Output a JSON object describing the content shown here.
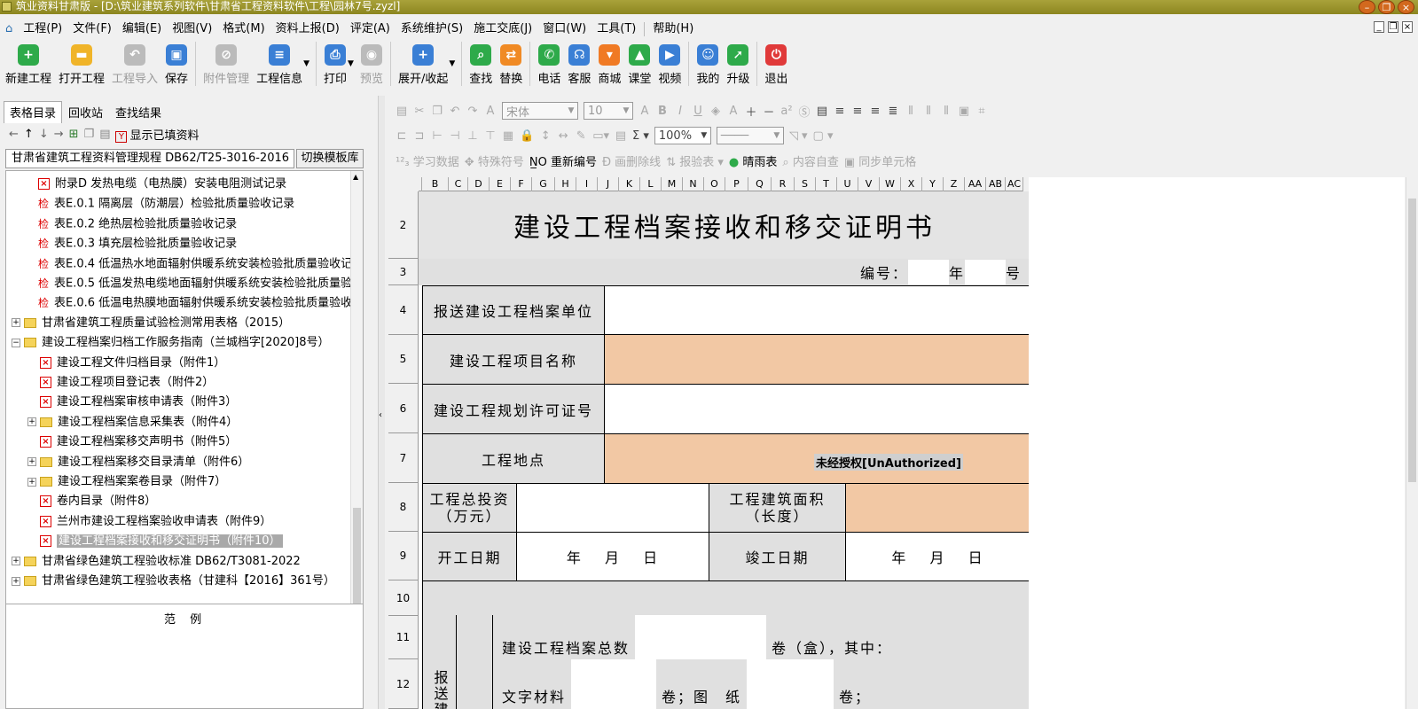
{
  "window": {
    "title": "筑业资料甘肃版 - [D:\\筑业建筑系列软件\\甘肃省工程资料软件\\工程\\园林7号.zyzl]"
  },
  "menu": [
    "工程(P)",
    "文件(F)",
    "编辑(E)",
    "视图(V)",
    "格式(M)",
    "资料上报(D)",
    "评定(A)",
    "系统维护(S)",
    "施工交底(J)",
    "窗口(W)",
    "工具(T)",
    "帮助(H)"
  ],
  "toolbar": {
    "new": "新建工程",
    "open": "打开工程",
    "import": "工程导入",
    "save": "保存",
    "attach": "附件管理",
    "info": "工程信息",
    "print": "打印",
    "preview": "预览",
    "expand": "展开/收起",
    "find": "查找",
    "replace": "替换",
    "phone": "电话",
    "service": "客服",
    "shop": "商城",
    "class": "课堂",
    "video": "视频",
    "mine": "我的",
    "upgrade": "升级",
    "exit": "退出"
  },
  "left": {
    "tabs": [
      "表格目录",
      "回收站",
      "查找结果"
    ],
    "show_filled": "显示已填资料",
    "spec": "甘肃省建筑工程资料管理规程 DB62/T25-3016-2016",
    "switch_btn": "切换模板库",
    "legend_title": "范 例",
    "tree": [
      {
        "label": "附录D 发热电缆（电热膜）安装电阻测试记录",
        "icon": "x",
        "level": 2
      },
      {
        "label": "表E.0.1 隔离层（防潮层）检验批质量验收记录",
        "icon": "j",
        "level": 2
      },
      {
        "label": "表E.0.2 绝热层检验批质量验收记录",
        "icon": "j",
        "level": 2
      },
      {
        "label": "表E.0.3 填充层检验批质量验收记录",
        "icon": "j",
        "level": 2
      },
      {
        "label": "表E.0.4 低温热水地面辐射供暖系统安装检验批质量验收记",
        "icon": "j",
        "level": 2
      },
      {
        "label": "表E.0.5 低温发热电缆地面辐射供暖系统安装检验批质量验",
        "icon": "j",
        "level": 2
      },
      {
        "label": "表E.0.6 低温电热膜地面辐射供暖系统安装检验批质量验收",
        "icon": "j",
        "level": 2
      },
      {
        "label": "甘肃省建筑工程质量试验检测常用表格（2015）",
        "icon": "folder",
        "toggle": "+",
        "level": 0
      },
      {
        "label": "建设工程档案归档工作服务指南（兰城档字[2020]8号）",
        "icon": "folder",
        "toggle": "-",
        "level": 0
      },
      {
        "label": "建设工程文件归档目录（附件1）",
        "icon": "x",
        "level": 1
      },
      {
        "label": "建设工程项目登记表（附件2）",
        "icon": "x",
        "level": 1
      },
      {
        "label": "建设工程档案审核申请表（附件3）",
        "icon": "x",
        "level": 1
      },
      {
        "label": "建设工程档案信息采集表（附件4）",
        "icon": "folder",
        "toggle": "+",
        "level": 1
      },
      {
        "label": "建设工程档案移交声明书（附件5）",
        "icon": "x",
        "level": 1
      },
      {
        "label": "建设工程档案移交目录清单（附件6）",
        "icon": "folder",
        "toggle": "+",
        "level": 1
      },
      {
        "label": "建设工程档案案卷目录（附件7）",
        "icon": "folder",
        "toggle": "+",
        "level": 1
      },
      {
        "label": "卷内目录（附件8）",
        "icon": "x",
        "level": 1
      },
      {
        "label": "兰州市建设工程档案验收申请表（附件9）",
        "icon": "x",
        "level": 1
      },
      {
        "label": "建设工程档案接收和移交证明书（附件10）",
        "icon": "x",
        "level": 1,
        "selected": true
      },
      {
        "label": "甘肃省绿色建筑工程验收标准 DB62/T3081-2022",
        "icon": "folder",
        "toggle": "+",
        "level": 0
      },
      {
        "label": "甘肃省绿色建筑工程验收表格（甘建科【2016】361号）",
        "icon": "folder",
        "toggle": "+",
        "level": 0
      }
    ]
  },
  "format": {
    "font": "宋体",
    "size": "10",
    "zoom": "100%",
    "study": "学习数据",
    "special": "特殊符号",
    "renumber": "重新编号",
    "strike": "画删除线",
    "inspect": "报验表",
    "weather": "晴雨表",
    "selfcheck": "内容自查",
    "sync": "同步单元格"
  },
  "sheet": {
    "columns": [
      "B",
      "C",
      "D",
      "E",
      "F",
      "G",
      "H",
      "I",
      "J",
      "K",
      "L",
      "M",
      "N",
      "O",
      "P",
      "Q",
      "R",
      "S",
      "T",
      "U",
      "V",
      "W",
      "X",
      "Y",
      "Z",
      "AA",
      "AB",
      "AC"
    ],
    "rows": [
      "2",
      "3",
      "4",
      "5",
      "6",
      "7",
      "8",
      "9",
      "10",
      "11",
      "12"
    ],
    "title": "建设工程档案接收和移交证明书",
    "number_label": "编号：",
    "year": "年",
    "no": "号",
    "labels": {
      "unit": "报送建设工程档案单位",
      "project": "建设工程项目名称",
      "permit": "建设工程规划许可证号",
      "location": "工程地点",
      "investment": "工程总投资\n（万元）",
      "area": "工程建筑面积\n（长度）",
      "start": "开工日期",
      "date_blank": "年　 月　 日",
      "finish": "竣工日期",
      "vertical": "报送建",
      "total": "建设工程档案总数",
      "boxes": "卷（盒），其中：",
      "text": "文字材料",
      "drawing": "卷；图　纸",
      "vol": "卷；"
    },
    "watermark": "未经授权[UnAuthorized]"
  }
}
